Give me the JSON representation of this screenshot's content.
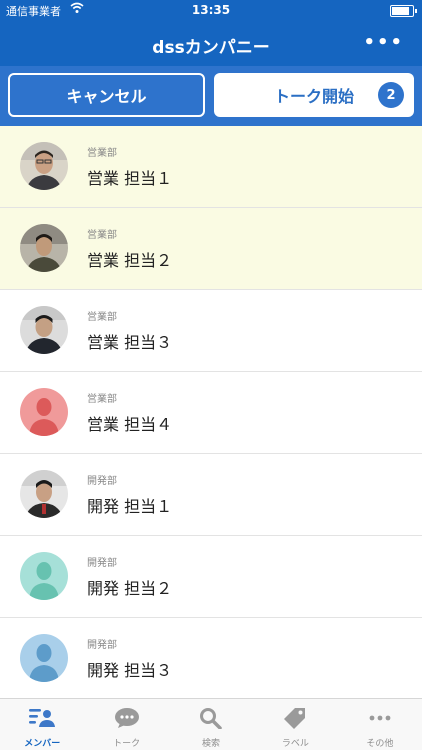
{
  "status_bar": {
    "carrier": "通信事業者",
    "time": "13:35",
    "battery_level": 0.95
  },
  "header": {
    "title": "dssカンパニー",
    "more_label": "•••"
  },
  "actions": {
    "cancel_label": "キャンセル",
    "start_label": "トーク開始",
    "selected_count": "2"
  },
  "members": [
    {
      "dept": "営業部",
      "name": "営業 担当１",
      "selected": true,
      "avatar": "photo"
    },
    {
      "dept": "営業部",
      "name": "営業 担当２",
      "selected": true,
      "avatar": "photo"
    },
    {
      "dept": "営業部",
      "name": "営業 担当３",
      "selected": false,
      "avatar": "photo"
    },
    {
      "dept": "営業部",
      "name": "営業 担当４",
      "selected": false,
      "avatar": "placeholder",
      "avatar_color": "#e57373"
    },
    {
      "dept": "開発部",
      "name": "開発 担当１",
      "selected": false,
      "avatar": "photo"
    },
    {
      "dept": "開発部",
      "name": "開発 担当２",
      "selected": false,
      "avatar": "placeholder",
      "avatar_color": "#80cbc4"
    },
    {
      "dept": "開発部",
      "name": "開発 担当３",
      "selected": false,
      "avatar": "placeholder",
      "avatar_color": "#90bfe0"
    }
  ],
  "tabs": [
    {
      "label": "メンバー",
      "icon": "members-icon",
      "active": true
    },
    {
      "label": "トーク",
      "icon": "chat-bubble-icon",
      "active": false
    },
    {
      "label": "検索",
      "icon": "search-icon",
      "active": false
    },
    {
      "label": "ラベル",
      "icon": "tag-icon",
      "active": false
    },
    {
      "label": "その他",
      "icon": "more-icon",
      "active": false
    }
  ],
  "colors": {
    "primary": "#1565c0",
    "action_bar": "#2e73cc",
    "selected_row": "#fafbe3"
  }
}
